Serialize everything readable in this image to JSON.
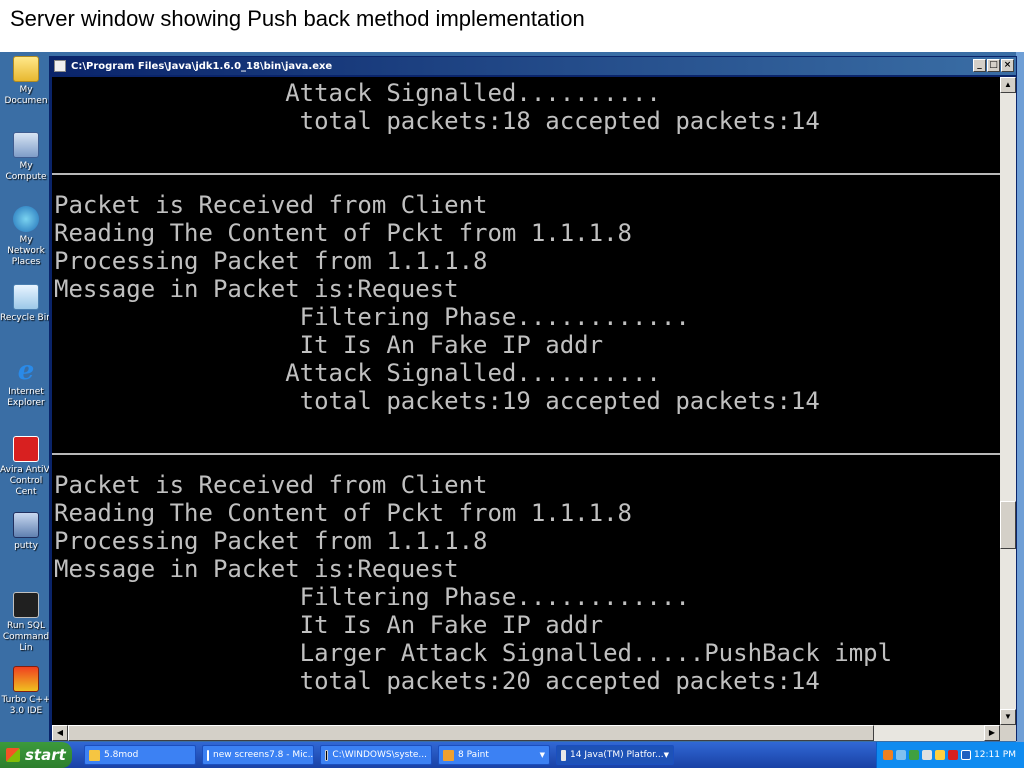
{
  "slide": {
    "title": "Server window showing Push back method implementation"
  },
  "desktop_icons": [
    {
      "label": "My Documen",
      "icon": "folder-icon"
    },
    {
      "label": "My Compute",
      "icon": "computer-icon"
    },
    {
      "label": "My Network Places",
      "icon": "network-icon"
    },
    {
      "label": "Recycle Bin",
      "icon": "recycle-bin-icon"
    },
    {
      "label": "Internet Explorer",
      "icon": "internet-explorer-icon"
    },
    {
      "label": "Avira AntiVi Control Cent",
      "icon": "avira-icon"
    },
    {
      "label": "putty",
      "icon": "putty-icon"
    },
    {
      "label": "Run SQL Command Lin",
      "icon": "sql-icon"
    },
    {
      "label": "Turbo C++ 3.0 IDE",
      "icon": "turbo-cpp-icon"
    }
  ],
  "window": {
    "title": "C:\\Program Files\\Java\\jdk1.6.0_18\\bin\\java.exe",
    "minimize": "_",
    "maximize": "□",
    "close": "×"
  },
  "console": {
    "lines": [
      "                Attack Signalled..........",
      "                 total packets:18 accepted packets:14",
      "Packet is Received from Client",
      "Reading The Content of Pckt from 1.1.1.8",
      "Processing Packet from 1.1.1.8",
      "Message in Packet is:Request",
      "                 Filtering Phase............",
      "                 It Is An Fake IP addr",
      "                Attack Signalled..........",
      "                 total packets:19 accepted packets:14",
      "Packet is Received from Client",
      "Reading The Content of Pckt from 1.1.1.8",
      "Processing Packet from 1.1.1.8",
      "Message in Packet is:Request",
      "                 Filtering Phase............",
      "                 It Is An Fake IP addr",
      "                 Larger Attack Signalled.....PushBack impl",
      "                 total packets:20 accepted packets:14"
    ]
  },
  "taskbar": {
    "start_label": "start",
    "tasks": [
      {
        "label": "5.8mod",
        "icon": "folder-icon",
        "color": "#f5c542"
      },
      {
        "label": "new screens7.8 - Mic...",
        "icon": "word-icon",
        "color": "#2b5797"
      },
      {
        "label": "C:\\WINDOWS\\syste...",
        "icon": "cmd-icon",
        "color": "#000000"
      },
      {
        "label": "8 Paint",
        "icon": "paint-icon",
        "color": "#f0a030"
      },
      {
        "label": "14 Java(TM) Platfor...",
        "icon": "java-icon",
        "color": "#e8e8e8"
      }
    ],
    "clock": "12:11 PM"
  }
}
